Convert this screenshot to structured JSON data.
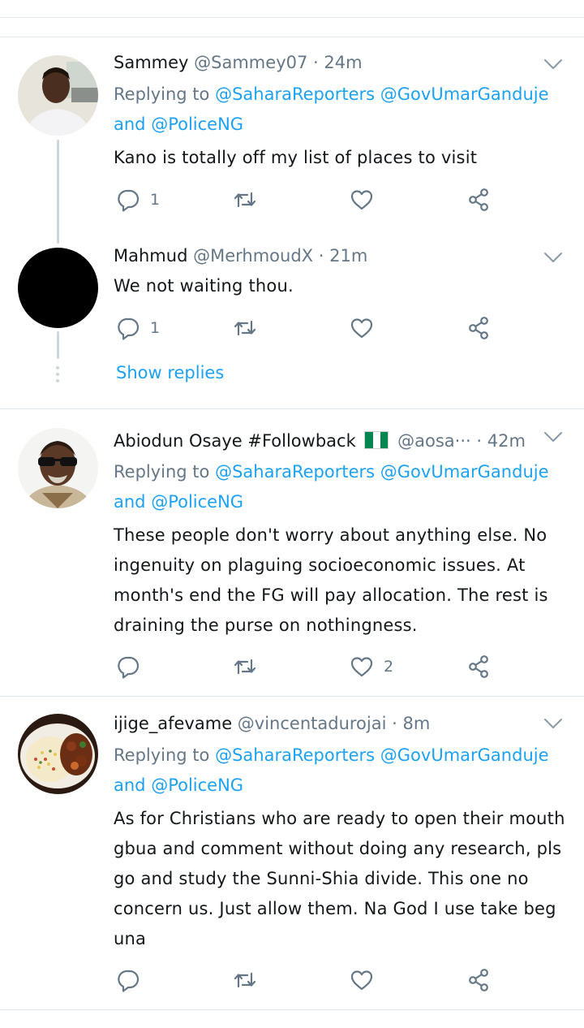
{
  "tweets": [
    {
      "name": "Sammey",
      "handle": "@Sammey07",
      "time": "24m",
      "replying_prefix": "Replying to",
      "mention1": "@SaharaReporters",
      "mention2": "@GovUmarGanduje",
      "and_word": "and",
      "mention3": "@PoliceNG",
      "text": "Kano is totally off my list of places to visit",
      "replies": "1",
      "retweets": "",
      "likes": ""
    },
    {
      "name": "Mahmud",
      "handle": "@MerhmoudX",
      "time": "21m",
      "text": "We not waiting thou.",
      "replies": "1",
      "retweets": "",
      "likes": ""
    },
    {
      "name": "Abiodun Osaye #Followback",
      "handle": "@aosa···",
      "time": "42m",
      "replying_prefix": "Replying to",
      "mention1": "@SaharaReporters",
      "mention2": "@GovUmarGanduje",
      "and_word": "and",
      "mention3": "@PoliceNG",
      "text": "These people don't worry about anything else. No ingenuity on plaguing socioeconomic issues. At month's end the FG will pay allocation. The rest is draining the purse on nothingness.",
      "replies": "",
      "retweets": "",
      "likes": "2"
    },
    {
      "name": "ijige_afevame",
      "handle": "@vincentadurojai",
      "time": "8m",
      "replying_prefix": "Replying to",
      "mention1": "@SaharaReporters",
      "mention2": "@GovUmarGanduje",
      "and_word": "and",
      "mention3": "@PoliceNG",
      "text": "As for Christians who are ready to open their mouth gbua and comment without doing any research, pls go and study the Sunni-Shia divide. This one no concern us. Just allow them. Na God I use take beg una",
      "replies": "",
      "retweets": "",
      "likes": ""
    }
  ],
  "show_replies_label": "Show replies",
  "colors": {
    "accent": "#1da1f2",
    "muted": "#657786",
    "divider": "#e1e8ed"
  },
  "icons": [
    "reply-icon",
    "retweet-icon",
    "like-icon",
    "share-icon",
    "chevron-down-icon",
    "nigeria-flag-icon"
  ]
}
